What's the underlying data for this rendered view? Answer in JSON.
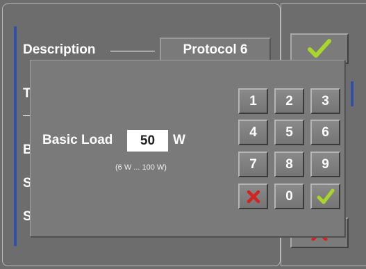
{
  "background": {
    "description_label": "Description",
    "protocol_value": "Protocol 6",
    "rows": [
      {
        "label": "T"
      },
      {
        "label": "B"
      },
      {
        "label": "S"
      },
      {
        "label": "S"
      }
    ]
  },
  "dialog": {
    "basic_load_label": "Basic Load",
    "basic_load_value": "50",
    "unit": "W",
    "range": "(6 W ... 100 W)"
  },
  "keypad": {
    "keys": [
      "1",
      "2",
      "3",
      "4",
      "5",
      "6",
      "7",
      "8",
      "9"
    ],
    "zero": "0",
    "cancel_icon": "x-icon",
    "confirm_icon": "check-icon"
  },
  "colors": {
    "accent_blue": "#2f4fa8",
    "check_green": "#a8d62a",
    "cancel_red": "#d42222"
  }
}
